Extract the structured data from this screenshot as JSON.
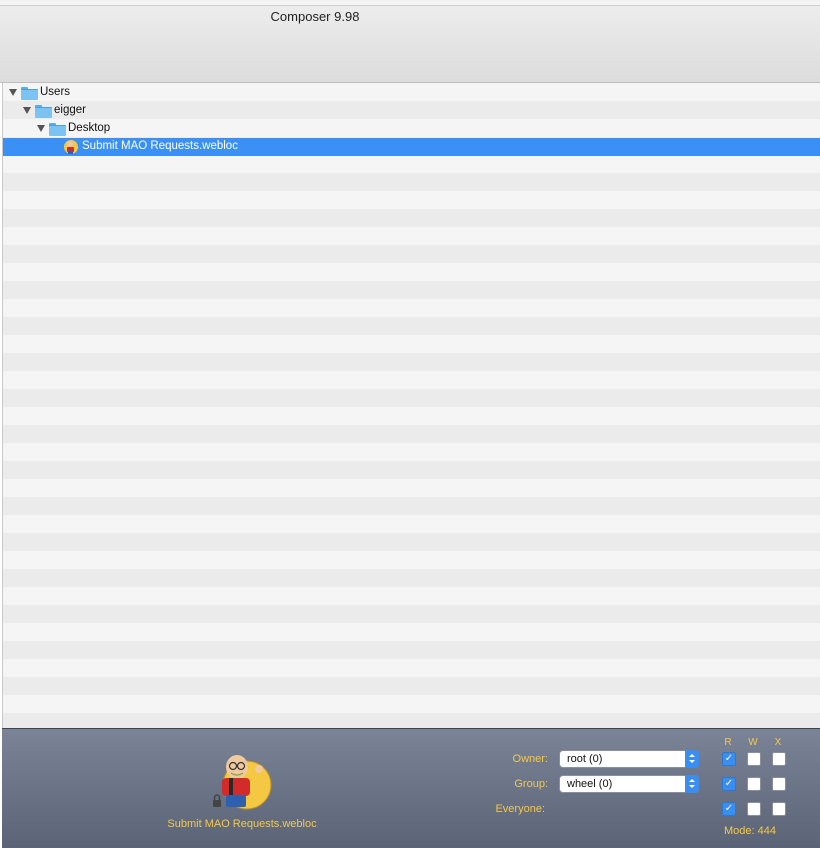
{
  "window": {
    "title": "Composer 9.98"
  },
  "tree": {
    "rows": [
      {
        "label": "Users",
        "kind": "folder",
        "expanded": true
      },
      {
        "label": "eigger",
        "kind": "folder",
        "expanded": true
      },
      {
        "label": "Desktop",
        "kind": "folder",
        "expanded": true
      },
      {
        "label": "Submit MAO Requests.webloc",
        "kind": "webloc",
        "selected": true
      }
    ]
  },
  "inspector": {
    "filename": "Submit MAO Requests.webloc",
    "columns": {
      "r": "R",
      "w": "W",
      "x": "X"
    },
    "owner": {
      "label": "Owner:",
      "value": "root (0)",
      "r": true,
      "w": false,
      "x": false
    },
    "group": {
      "label": "Group:",
      "value": "wheel (0)",
      "r": true,
      "w": false,
      "x": false
    },
    "everyone": {
      "label": "Everyone:",
      "r": true,
      "w": false,
      "x": false
    },
    "mode": "Mode: 444"
  },
  "colors": {
    "selection": "#3a90f5",
    "accent_text": "#f5c84a",
    "checkbox_on": "#3a8ef0"
  }
}
